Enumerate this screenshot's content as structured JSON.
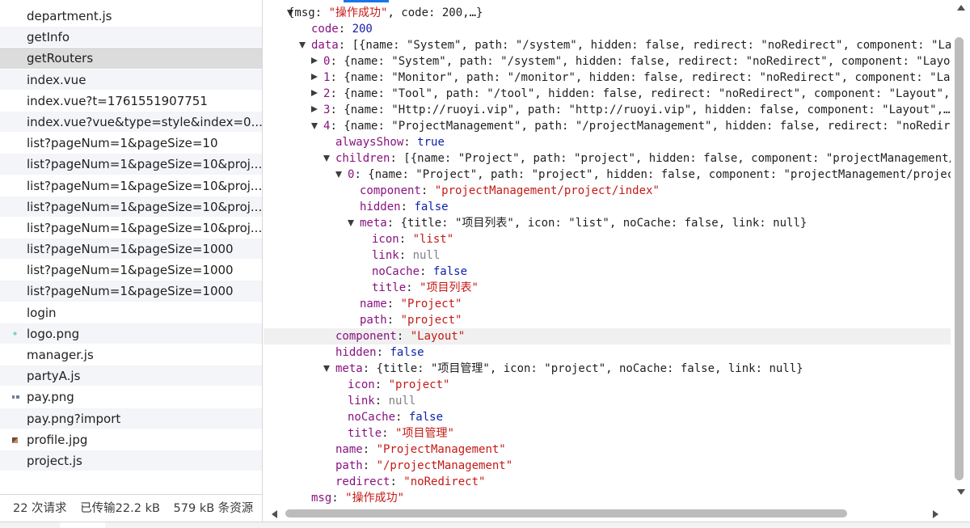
{
  "requests": [
    {
      "name": "department.js",
      "icon": ""
    },
    {
      "name": "getInfo",
      "icon": ""
    },
    {
      "name": "getRouters",
      "icon": ""
    },
    {
      "name": "index.vue",
      "icon": ""
    },
    {
      "name": "index.vue?t=1761551907751",
      "icon": ""
    },
    {
      "name": "index.vue?vue&type=style&index=0...",
      "icon": ""
    },
    {
      "name": "list?pageNum=1&pageSize=10",
      "icon": ""
    },
    {
      "name": "list?pageNum=1&pageSize=10&proj...",
      "icon": ""
    },
    {
      "name": "list?pageNum=1&pageSize=10&proj...",
      "icon": ""
    },
    {
      "name": "list?pageNum=1&pageSize=10&proj...",
      "icon": ""
    },
    {
      "name": "list?pageNum=1&pageSize=10&proj...",
      "icon": ""
    },
    {
      "name": "list?pageNum=1&pageSize=1000",
      "icon": ""
    },
    {
      "name": "list?pageNum=1&pageSize=1000",
      "icon": ""
    },
    {
      "name": "list?pageNum=1&pageSize=1000",
      "icon": ""
    },
    {
      "name": "login",
      "icon": ""
    },
    {
      "name": "logo.png",
      "icon": "image-icon"
    },
    {
      "name": "manager.js",
      "icon": ""
    },
    {
      "name": "partyA.js",
      "icon": ""
    },
    {
      "name": "pay.png",
      "icon": "image-icon"
    },
    {
      "name": "pay.png?import",
      "icon": ""
    },
    {
      "name": "profile.jpg",
      "icon": "image-icon"
    },
    {
      "name": "project.js",
      "icon": ""
    }
  ],
  "selected_request": "getRouters",
  "status": {
    "requests": "22 次请求",
    "transferred": "已传输22.2 kB",
    "resources": "579 kB 条资源"
  },
  "json_lines": [
    {
      "indent": 0,
      "arrow": "down",
      "parts": [
        [
          "p",
          "{msg: "
        ],
        [
          "s",
          "\"操作成功\""
        ],
        [
          "p",
          ", code: 200,…}"
        ]
      ]
    },
    {
      "indent": 1,
      "arrow": "",
      "parts": [
        [
          "k",
          "code"
        ],
        [
          "p",
          ": "
        ],
        [
          "n",
          "200"
        ]
      ]
    },
    {
      "indent": 1,
      "arrow": "down",
      "parts": [
        [
          "k",
          "data"
        ],
        [
          "p",
          ": [{name: \"System\", path: \"/system\", hidden: false, redirect: \"noRedirect\", component: \"Layout\",…"
        ]
      ]
    },
    {
      "indent": 2,
      "arrow": "right",
      "parts": [
        [
          "k",
          "0"
        ],
        [
          "p",
          ": {name: \"System\", path: \"/system\", hidden: false, redirect: \"noRedirect\", component: \"Layout\","
        ]
      ]
    },
    {
      "indent": 2,
      "arrow": "right",
      "parts": [
        [
          "k",
          "1"
        ],
        [
          "p",
          ": {name: \"Monitor\", path: \"/monitor\", hidden: false, redirect: \"noRedirect\", component: \"Layout\","
        ]
      ]
    },
    {
      "indent": 2,
      "arrow": "right",
      "parts": [
        [
          "k",
          "2"
        ],
        [
          "p",
          ": {name: \"Tool\", path: \"/tool\", hidden: false, redirect: \"noRedirect\", component: \"Layout\",…}"
        ]
      ]
    },
    {
      "indent": 2,
      "arrow": "right",
      "parts": [
        [
          "k",
          "3"
        ],
        [
          "p",
          ": {name: \"Http://ruoyi.vip\", path: \"http://ruoyi.vip\", hidden: false, component: \"Layout\",…}"
        ]
      ]
    },
    {
      "indent": 2,
      "arrow": "down",
      "parts": [
        [
          "k",
          "4"
        ],
        [
          "p",
          ": {name: \"ProjectManagement\", path: \"/projectManagement\", hidden: false, redirect: \"noRedirect\","
        ]
      ]
    },
    {
      "indent": 3,
      "arrow": "",
      "parts": [
        [
          "k",
          "alwaysShow"
        ],
        [
          "p",
          ": "
        ],
        [
          "b",
          "true"
        ]
      ]
    },
    {
      "indent": 3,
      "arrow": "down",
      "parts": [
        [
          "k",
          "children"
        ],
        [
          "p",
          ": [{name: \"Project\", path: \"project\", hidden: false, component: \"projectManagement/proj"
        ]
      ]
    },
    {
      "indent": 4,
      "arrow": "down",
      "parts": [
        [
          "k",
          "0"
        ],
        [
          "p",
          ": {name: \"Project\", path: \"project\", hidden: false, component: \"projectManagement/project/in"
        ]
      ]
    },
    {
      "indent": 5,
      "arrow": "",
      "parts": [
        [
          "k",
          "component"
        ],
        [
          "p",
          ": "
        ],
        [
          "s",
          "\"projectManagement/project/index\""
        ]
      ]
    },
    {
      "indent": 5,
      "arrow": "",
      "parts": [
        [
          "k",
          "hidden"
        ],
        [
          "p",
          ": "
        ],
        [
          "b",
          "false"
        ]
      ]
    },
    {
      "indent": 5,
      "arrow": "down",
      "parts": [
        [
          "k",
          "meta"
        ],
        [
          "p",
          ": {title: \"项目列表\", icon: \"list\", noCache: false, link: null}"
        ]
      ]
    },
    {
      "indent": 6,
      "arrow": "",
      "parts": [
        [
          "k",
          "icon"
        ],
        [
          "p",
          ": "
        ],
        [
          "s",
          "\"list\""
        ]
      ]
    },
    {
      "indent": 6,
      "arrow": "",
      "parts": [
        [
          "k",
          "link"
        ],
        [
          "p",
          ": "
        ],
        [
          "nl",
          "null"
        ]
      ]
    },
    {
      "indent": 6,
      "arrow": "",
      "parts": [
        [
          "k",
          "noCache"
        ],
        [
          "p",
          ": "
        ],
        [
          "b",
          "false"
        ]
      ]
    },
    {
      "indent": 6,
      "arrow": "",
      "parts": [
        [
          "k",
          "title"
        ],
        [
          "p",
          ": "
        ],
        [
          "s",
          "\"项目列表\""
        ]
      ]
    },
    {
      "indent": 5,
      "arrow": "",
      "parts": [
        [
          "k",
          "name"
        ],
        [
          "p",
          ": "
        ],
        [
          "s",
          "\"Project\""
        ]
      ]
    },
    {
      "indent": 5,
      "arrow": "",
      "parts": [
        [
          "k",
          "path"
        ],
        [
          "p",
          ": "
        ],
        [
          "s",
          "\"project\""
        ]
      ]
    },
    {
      "indent": 3,
      "arrow": "",
      "hl": true,
      "parts": [
        [
          "k",
          "component"
        ],
        [
          "p",
          ": "
        ],
        [
          "s",
          "\"Layout\""
        ]
      ]
    },
    {
      "indent": 3,
      "arrow": "",
      "parts": [
        [
          "k",
          "hidden"
        ],
        [
          "p",
          ": "
        ],
        [
          "b",
          "false"
        ]
      ]
    },
    {
      "indent": 3,
      "arrow": "down",
      "parts": [
        [
          "k",
          "meta"
        ],
        [
          "p",
          ": {title: \"项目管理\", icon: \"project\", noCache: false, link: null}"
        ]
      ]
    },
    {
      "indent": 4,
      "arrow": "",
      "parts": [
        [
          "k",
          "icon"
        ],
        [
          "p",
          ": "
        ],
        [
          "s",
          "\"project\""
        ]
      ]
    },
    {
      "indent": 4,
      "arrow": "",
      "parts": [
        [
          "k",
          "link"
        ],
        [
          "p",
          ": "
        ],
        [
          "nl",
          "null"
        ]
      ]
    },
    {
      "indent": 4,
      "arrow": "",
      "parts": [
        [
          "k",
          "noCache"
        ],
        [
          "p",
          ": "
        ],
        [
          "b",
          "false"
        ]
      ]
    },
    {
      "indent": 4,
      "arrow": "",
      "parts": [
        [
          "k",
          "title"
        ],
        [
          "p",
          ": "
        ],
        [
          "s",
          "\"项目管理\""
        ]
      ]
    },
    {
      "indent": 3,
      "arrow": "",
      "parts": [
        [
          "k",
          "name"
        ],
        [
          "p",
          ": "
        ],
        [
          "s",
          "\"ProjectManagement\""
        ]
      ]
    },
    {
      "indent": 3,
      "arrow": "",
      "parts": [
        [
          "k",
          "path"
        ],
        [
          "p",
          ": "
        ],
        [
          "s",
          "\"/projectManagement\""
        ]
      ]
    },
    {
      "indent": 3,
      "arrow": "",
      "parts": [
        [
          "k",
          "redirect"
        ],
        [
          "p",
          ": "
        ],
        [
          "s",
          "\"noRedirect\""
        ]
      ]
    },
    {
      "indent": 1,
      "arrow": "",
      "parts": [
        [
          "k",
          "msg"
        ],
        [
          "p",
          ": "
        ],
        [
          "s",
          "\"操作成功\""
        ]
      ]
    }
  ]
}
